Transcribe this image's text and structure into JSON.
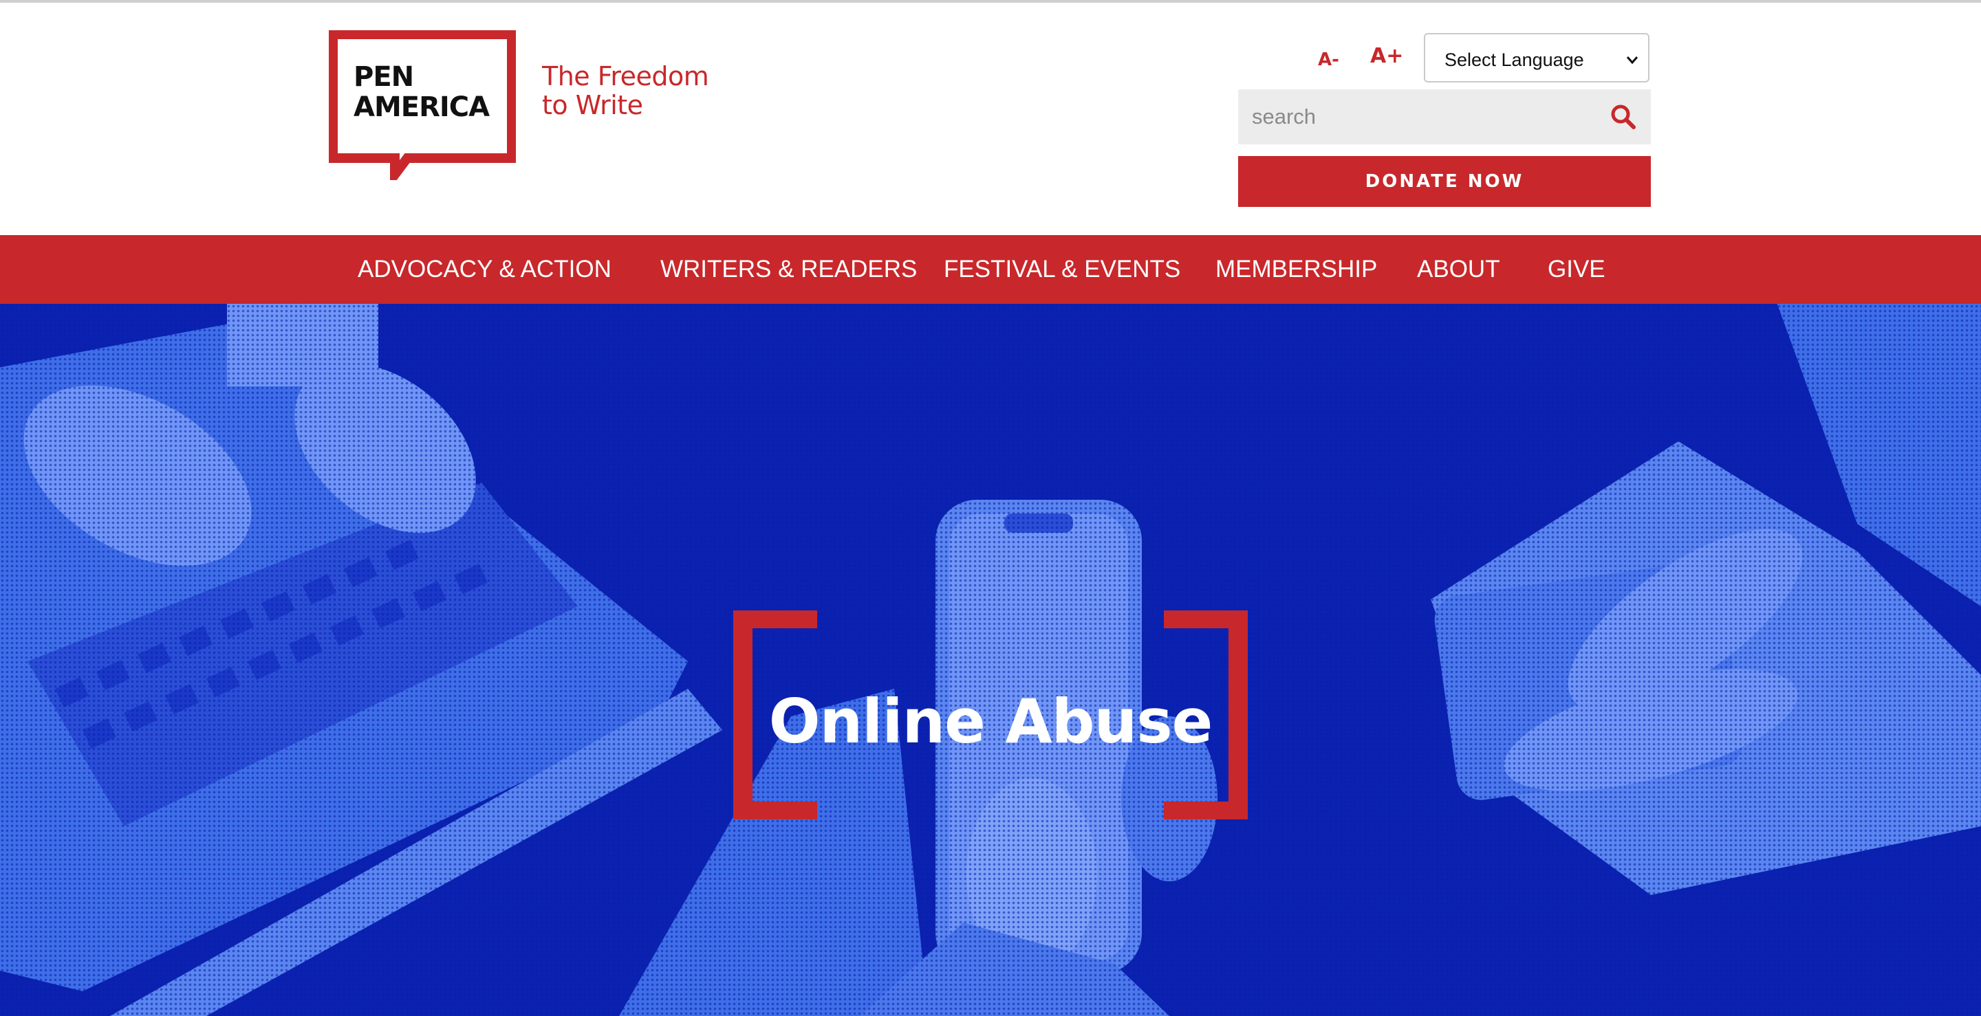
{
  "brand": {
    "logo_line1": "PEN",
    "logo_line2": "AMERICA",
    "tagline_line1": "The Freedom",
    "tagline_line2": "to Write",
    "accent_color": "#c8282b",
    "hero_color": "#0b22b0"
  },
  "utility": {
    "font_smaller": "A-",
    "font_larger": "A+",
    "language_select": "Select Language",
    "search_placeholder": "search",
    "donate": "DONATE NOW"
  },
  "nav": {
    "items": [
      "ADVOCACY & ACTION",
      "WRITERS & READERS",
      "FESTIVAL & EVENTS",
      "MEMBERSHIP",
      "ABOUT",
      "GIVE"
    ]
  },
  "hero": {
    "title": "Online Abuse"
  },
  "icons": {
    "search": "search-icon",
    "dropdown": "chevron-down-icon"
  }
}
